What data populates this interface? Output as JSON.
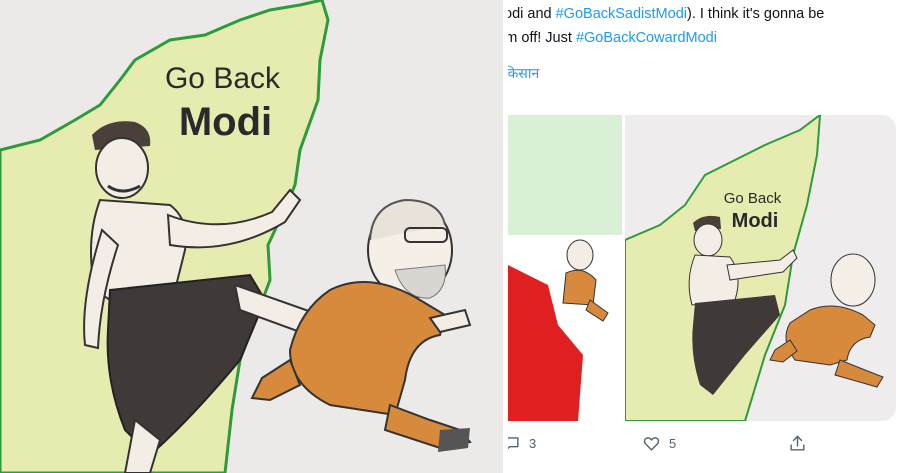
{
  "drawing": {
    "line1": "Go Back",
    "line2": "Modi"
  },
  "tweet": {
    "line1_parts": [
      "odi and ",
      "#GoBackSadistModi",
      "). I think it's gonna be"
    ],
    "line2_parts": [
      "him off! Just ",
      "#GoBackCowardModi"
    ],
    "translate_label": "किसान",
    "media": {
      "line1": "Go Back",
      "line2": "Modi"
    },
    "actions": {
      "reply_count": "3",
      "like_count": "5"
    }
  },
  "colors": {
    "link": "#1d9bf0",
    "text": "#0f1419",
    "muted": "#536471",
    "map_fill": "#e6ecb0",
    "map_outline": "#2f9a3a"
  },
  "icons": [
    "reply-icon",
    "heart-icon",
    "share-icon"
  ]
}
